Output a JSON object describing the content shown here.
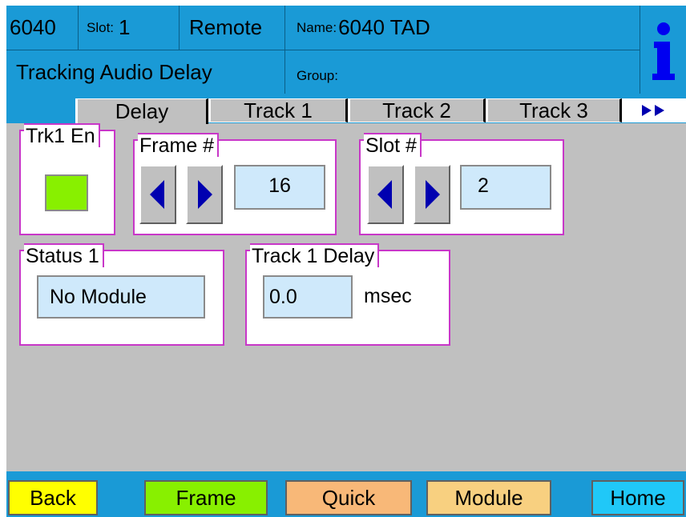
{
  "header": {
    "model": "6040",
    "slot_label": "Slot:",
    "slot_value": "1",
    "mode": "Remote",
    "name_label": "Name:",
    "name_value": "6040 TAD",
    "description": "Tracking Audio Delay",
    "group_label": "Group:",
    "group_value": ""
  },
  "tabs": [
    {
      "label": "Delay"
    },
    {
      "label": "Track 1"
    },
    {
      "label": "Track 2"
    },
    {
      "label": "Track 3"
    }
  ],
  "panels": {
    "trk_enable": {
      "label": "Trk1 En",
      "state": "on",
      "led_color": "#88f000"
    },
    "frame": {
      "label": "Frame #",
      "value": "16"
    },
    "slot": {
      "label": "Slot #",
      "value": "2"
    },
    "status": {
      "label": "Status 1",
      "value": "No Module"
    },
    "delay": {
      "label": "Track 1 Delay",
      "value": "0.0",
      "unit": "msec"
    }
  },
  "footer": [
    {
      "label": "Back",
      "color": "#ffff00"
    },
    {
      "label": "Frame",
      "color": "#88f000"
    },
    {
      "label": "Quick",
      "color": "#f8b878"
    },
    {
      "label": "Module",
      "color": "#f8d080"
    },
    {
      "label": "Home",
      "color": "#20c8f8"
    }
  ],
  "colors": {
    "header_bg": "#1a9ad6",
    "group_border": "#c837c8",
    "field_bg": "#cfe9fb",
    "arrow_color": "#0000b0"
  }
}
